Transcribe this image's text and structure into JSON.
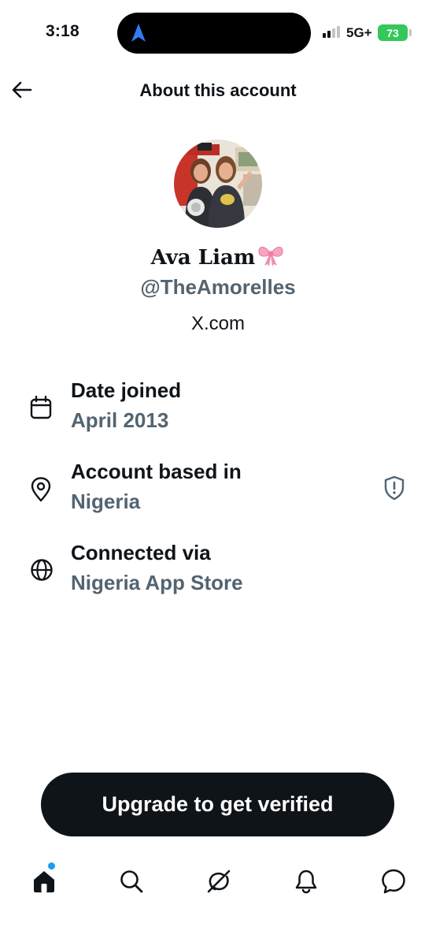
{
  "status_bar": {
    "time": "3:18",
    "network": "5G+",
    "battery": "73"
  },
  "header": {
    "title": "About this account",
    "back_icon": "arrow-left-icon"
  },
  "profile": {
    "display_name": "Ava Liam",
    "name_emoji": "ribbon-bow",
    "handle": "@TheAmorelles",
    "source": "X.com"
  },
  "info_rows": [
    {
      "icon": "calendar-icon",
      "label": "Date joined",
      "value": "April 2013"
    },
    {
      "icon": "location-pin-icon",
      "label": "Account based in",
      "value": "Nigeria",
      "trailing_icon": "shield-alert-icon"
    },
    {
      "icon": "globe-icon",
      "label": "Connected via",
      "value": "Nigeria App Store"
    }
  ],
  "cta": {
    "label": "Upgrade to get verified"
  },
  "tab_bar": {
    "items": [
      "home-icon",
      "search-icon",
      "grok-icon",
      "notifications-bell-icon",
      "messages-icon"
    ],
    "home_has_badge": true
  },
  "colors": {
    "text_primary": "#0f1419",
    "text_secondary": "#536471",
    "accent": "#1d9bf0",
    "battery": "#34c759"
  }
}
